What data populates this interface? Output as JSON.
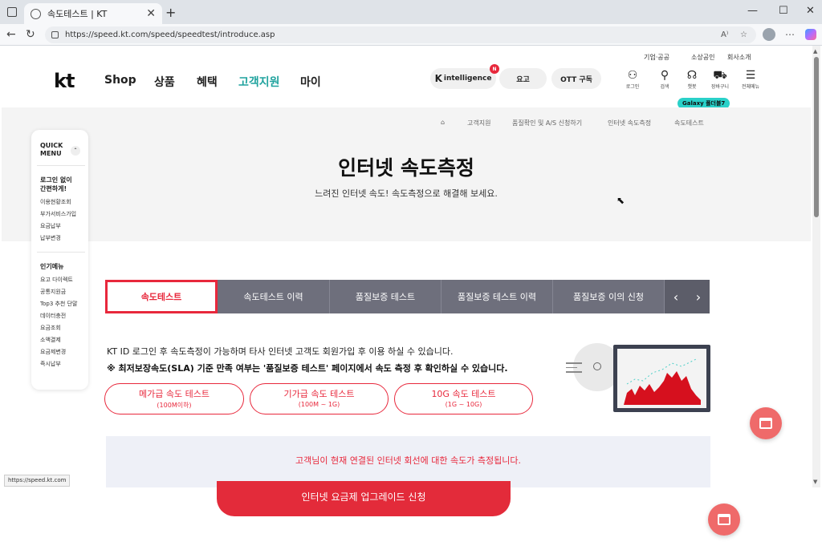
{
  "browser": {
    "tab_title": "속도테스트 | KT",
    "url": "https://speed.kt.com/speed/speedtest/introduce.asp",
    "status_url": "https://speed.kt.com"
  },
  "header": {
    "util_links": [
      "기업·공공",
      "소상공인",
      "회사소개"
    ],
    "logo": "kt",
    "gnb": [
      "Shop",
      "상품",
      "혜택",
      "고객지원",
      "마이"
    ],
    "pills": {
      "k_intelligence": "intelligence",
      "k_letter": "K",
      "new_badge": "N",
      "plan": "요고",
      "ott": "OTT 구독"
    },
    "icons": [
      {
        "label": "로그인",
        "icon": "person-icon"
      },
      {
        "label": "검색",
        "icon": "search-icon"
      },
      {
        "label": "챗봇",
        "icon": "headset-icon"
      },
      {
        "label": "장바구니",
        "icon": "cart-icon"
      },
      {
        "label": "전체메뉴",
        "icon": "menu-icon"
      }
    ],
    "galaxy_badge": "Galaxy 폴더블7"
  },
  "breadcrumb": [
    "고객지원",
    "품질확인 및 A/S 신청하기",
    "인터넷 속도측정",
    "속도테스트"
  ],
  "hero": {
    "title": "인터넷 속도측정",
    "subtitle": "느려진 인터넷 속도! 속도측정으로 해결해 보세요."
  },
  "quick_menu": {
    "title_line1": "QUICK",
    "title_line2": "MENU",
    "section1_title_line1": "로그인 없이",
    "section1_title_line2": "간편하게!",
    "section1_items": [
      "이용현황조회",
      "부가서비스가입",
      "요금납부",
      "납부변경"
    ],
    "section2_title": "인기메뉴",
    "section2_items": [
      "요고 다이렉트",
      "공통지원금",
      "Top3 추천 단말",
      "데이터충전",
      "요금조회",
      "소액결제",
      "요금제변경",
      "즉시납부"
    ]
  },
  "tabs": [
    "속도테스트",
    "속도테스트 이력",
    "품질보증 테스트",
    "품질보증 테스트 이력",
    "품질보증 이의 신청"
  ],
  "info": {
    "line1": "KT ID 로그인 후 속도측정이 가능하며 타사 인터넷 고객도 회원가입 후 이용 하실 수 있습니다.",
    "line2": "※ 최저보장속도(SLA) 기준 만족 여부는 '품질보증 테스트' 페이지에서 속도 측정 후 확인하실 수 있습니다."
  },
  "test_buttons": [
    {
      "label": "메가급 속도 테스트",
      "sub": "(100M이하)"
    },
    {
      "label": "기가급 속도 테스트",
      "sub": "(100M ~ 1G)"
    },
    {
      "label": "10G 속도 테스트",
      "sub": "(1G ~ 10G)"
    }
  ],
  "measure_notice": "고객님이 현재 연결된 인터넷 회선에 대한 속도가 측정됩니다.",
  "upgrade_button": "인터넷 요금제 업그레이드 신청",
  "colors": {
    "accent_red": "#e8283c",
    "tab_bg": "#6e6f7c",
    "active_gnb": "#20a39e",
    "badge_teal": "#2ad1c9"
  }
}
